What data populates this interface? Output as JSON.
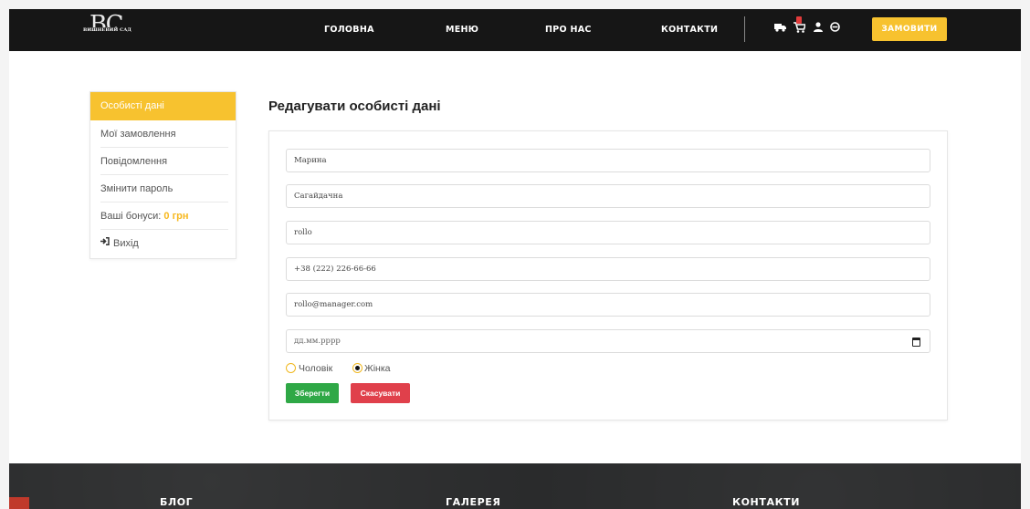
{
  "header": {
    "logo": {
      "mark": "BC",
      "subtitle": "ВИШНЕВИЙ САД"
    },
    "nav": [
      {
        "label": "ГОЛОВНА"
      },
      {
        "label": "МЕНЮ"
      },
      {
        "label": "ПРО НАС"
      },
      {
        "label": "КОНТАКТИ"
      }
    ],
    "icons": [
      "delivery-truck-icon",
      "cart-icon",
      "user-icon",
      "globe-icon"
    ],
    "order_button": "ЗАМОВИТИ",
    "colors": {
      "background": "#161616",
      "accent": "#f7c22f",
      "badge": "#e23b3b"
    }
  },
  "sidebar": {
    "items": [
      {
        "label": "Особисті дані",
        "active": true
      },
      {
        "label": "Мої замовлення"
      },
      {
        "label": "Повідомлення"
      },
      {
        "label": "Змінити пароль"
      },
      {
        "label": "Ваші бонуси:",
        "value": "0 грн"
      },
      {
        "label": "Вихід",
        "icon": "sign-out-icon"
      }
    ]
  },
  "main": {
    "title": "Редагувати особисті дані",
    "fields": {
      "first_name": "Марина",
      "last_name": "Сагайдачна",
      "login": "rollo",
      "phone": "+38 (222) 226-66-66",
      "email": "rollo@manager.com",
      "birth_date_placeholder": "дд.мм.рррр"
    },
    "gender": {
      "options": [
        "Чоловік",
        "Жінка"
      ],
      "selected": "Жінка"
    },
    "buttons": {
      "save": "Зберегти",
      "cancel": "Скасувати"
    },
    "colors": {
      "save": "#2fa846",
      "cancel": "#e0404b"
    }
  },
  "footer": {
    "headings": [
      "БЛОГ",
      "ГАЛЕРЕЯ",
      "КОНТАКТИ"
    ]
  }
}
